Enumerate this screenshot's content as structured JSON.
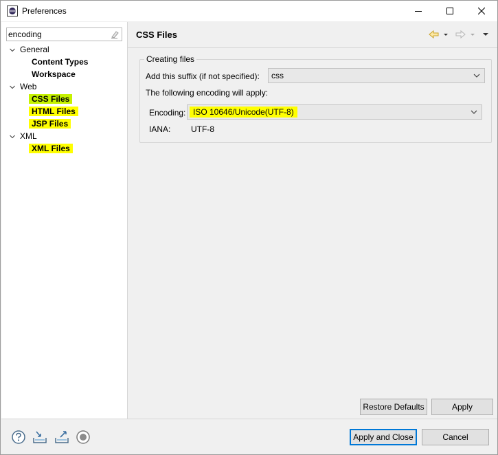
{
  "window": {
    "title": "Preferences",
    "controls": {
      "minimize": "minimize-icon",
      "maximize": "maximize-icon",
      "close": "close-icon"
    }
  },
  "filter": {
    "value": "encoding"
  },
  "tree": {
    "items": [
      {
        "label": "General",
        "level": 0,
        "expanded": true
      },
      {
        "label": "Content Types",
        "level": 1
      },
      {
        "label": "Workspace",
        "level": 1
      },
      {
        "label": "Web",
        "level": 0,
        "expanded": true
      },
      {
        "label": "CSS Files",
        "level": 1,
        "selected": true
      },
      {
        "label": "HTML Files",
        "level": 1
      },
      {
        "label": "JSP Files",
        "level": 1
      },
      {
        "label": "XML",
        "level": 0,
        "expanded": true
      },
      {
        "label": "XML Files",
        "level": 1
      }
    ]
  },
  "page": {
    "title": "CSS Files",
    "group_title": "Creating files",
    "suffix_label": "Add this suffix (if not specified):",
    "suffix_value": "css",
    "encoding_note": "The following encoding will apply:",
    "encoding_label": "Encoding:",
    "encoding_value": "ISO 10646/Unicode(UTF-8)",
    "iana_label": "IANA:",
    "iana_value": "UTF-8"
  },
  "buttons": {
    "restore_defaults": "Restore Defaults",
    "apply": "Apply",
    "apply_and_close": "Apply and Close",
    "cancel": "Cancel"
  },
  "colors": {
    "highlight": "#ffff00",
    "selected_highlight": "#c6f200",
    "default_button_border": "#0078d7"
  }
}
